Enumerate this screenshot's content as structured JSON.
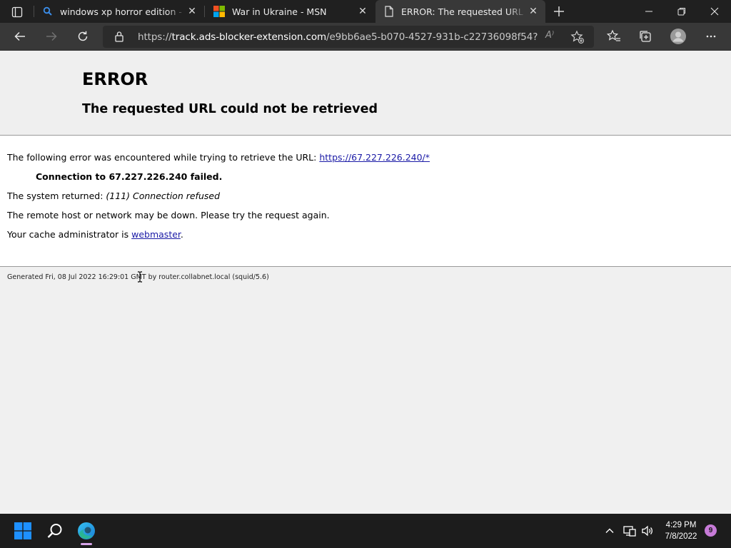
{
  "browser": {
    "tabs": [
      {
        "title": "windows xp horror edition - Sear",
        "icon": "search-icon"
      },
      {
        "title": "War in Ukraine - MSN",
        "icon": "msn-logo-icon"
      },
      {
        "title": "ERROR: The requested URL could",
        "icon": "page-icon",
        "active": true
      }
    ],
    "address": {
      "scheme": "https://",
      "host": "track.ads-blocker-extension.com",
      "path": "/e9bb6ae5-b070-4527-931b-c22736098f54?subi..."
    },
    "read_aloud_label": "A⁾"
  },
  "page": {
    "title": "ERROR",
    "subtitle": "The requested URL could not be retrieved",
    "line1_prefix": "The following error was encountered while trying to retrieve the URL: ",
    "line1_link": "https://67.227.226.240/*",
    "line2": "Connection to 67.227.226.240 failed.",
    "line3_prefix": "The system returned: ",
    "line3_detail": "(111) Connection refused",
    "line4": "The remote host or network may be down. Please try the request again.",
    "line5_prefix": "Your cache administrator is ",
    "line5_link": "webmaster",
    "line5_suffix": ".",
    "footer": "Generated Fri, 08 Jul 2022 16:29:01 GMT by router.collabnet.local (squid/5.6)"
  },
  "taskbar": {
    "time": "4:29 PM",
    "date": "7/8/2022",
    "notifications": "9"
  },
  "colors": {
    "link": "#1a1aa6",
    "edge_indicator": "#d7a4e8",
    "notification_badge": "#c77bd8"
  }
}
